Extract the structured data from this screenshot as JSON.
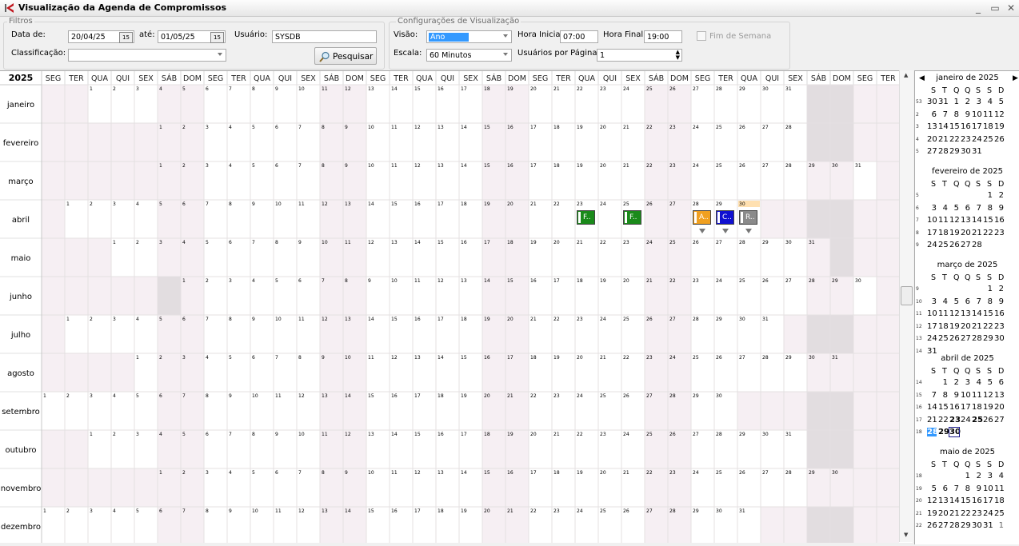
{
  "window": {
    "title": "Visualização da Agenda de Compromissos",
    "minimize": "_",
    "maximize": "▭",
    "close": "✕"
  },
  "filters": {
    "legend": "Filtros",
    "date_from_label": "Data de:",
    "date_from": "20/04/25",
    "date_to_label": "até:",
    "date_to": "01/05/25",
    "user_label": "Usuário:",
    "user": "SYSDB",
    "classification_label": "Classificação:",
    "classification": "",
    "search_button": "Pesquisar"
  },
  "view_config": {
    "legend": "Configurações de Visualização",
    "view_label": "Visão:",
    "view": "Ano",
    "start_hour_label": "Hora Inicial",
    "start_hour": "07:00",
    "end_hour_label": "Hora Final",
    "end_hour": "19:00",
    "weekend_label": "Fim de Semana",
    "scale_label": "Escala:",
    "scale": "60 Minutos",
    "users_per_page_label": "Usuários por Página",
    "users_per_page": "1"
  },
  "year_view": {
    "year": "2025",
    "weekdays": [
      "SEG",
      "TER",
      "QUA",
      "QUI",
      "SEX",
      "SÁB",
      "DOM"
    ],
    "months": [
      "janeiro",
      "fevereiro",
      "março",
      "abril",
      "maio",
      "junho",
      "julho",
      "agosto",
      "setembro",
      "outubro",
      "novembro",
      "dezembro"
    ],
    "highlight_date": "30",
    "events": [
      {
        "day": 23,
        "label": "F..",
        "color": "#1a8a1a"
      },
      {
        "day": 25,
        "label": "F..",
        "color": "#1a8a1a"
      },
      {
        "day": 28,
        "label": "A..",
        "color": "#f0a020"
      },
      {
        "day": 29,
        "label": "C..",
        "color": "#1010d0"
      },
      {
        "day": 30,
        "label": "R..",
        "color": "#8a8a8a"
      }
    ]
  },
  "mini_calendars": {
    "weekday_initials": [
      "S",
      "T",
      "Q",
      "Q",
      "S",
      "S",
      "D"
    ],
    "months": [
      {
        "title": "janeiro de 2025"
      },
      {
        "title": "fevereiro de 2025"
      },
      {
        "title": "março de 2025"
      },
      {
        "title": "abril de 2025"
      },
      {
        "title": "maio de 2025"
      }
    ]
  },
  "colors": {
    "weekend_col": "#f6eff3",
    "empty_cell": "#f6eff3",
    "dark_cell": "#e2dde0",
    "highlight": "#ffe0b0"
  }
}
